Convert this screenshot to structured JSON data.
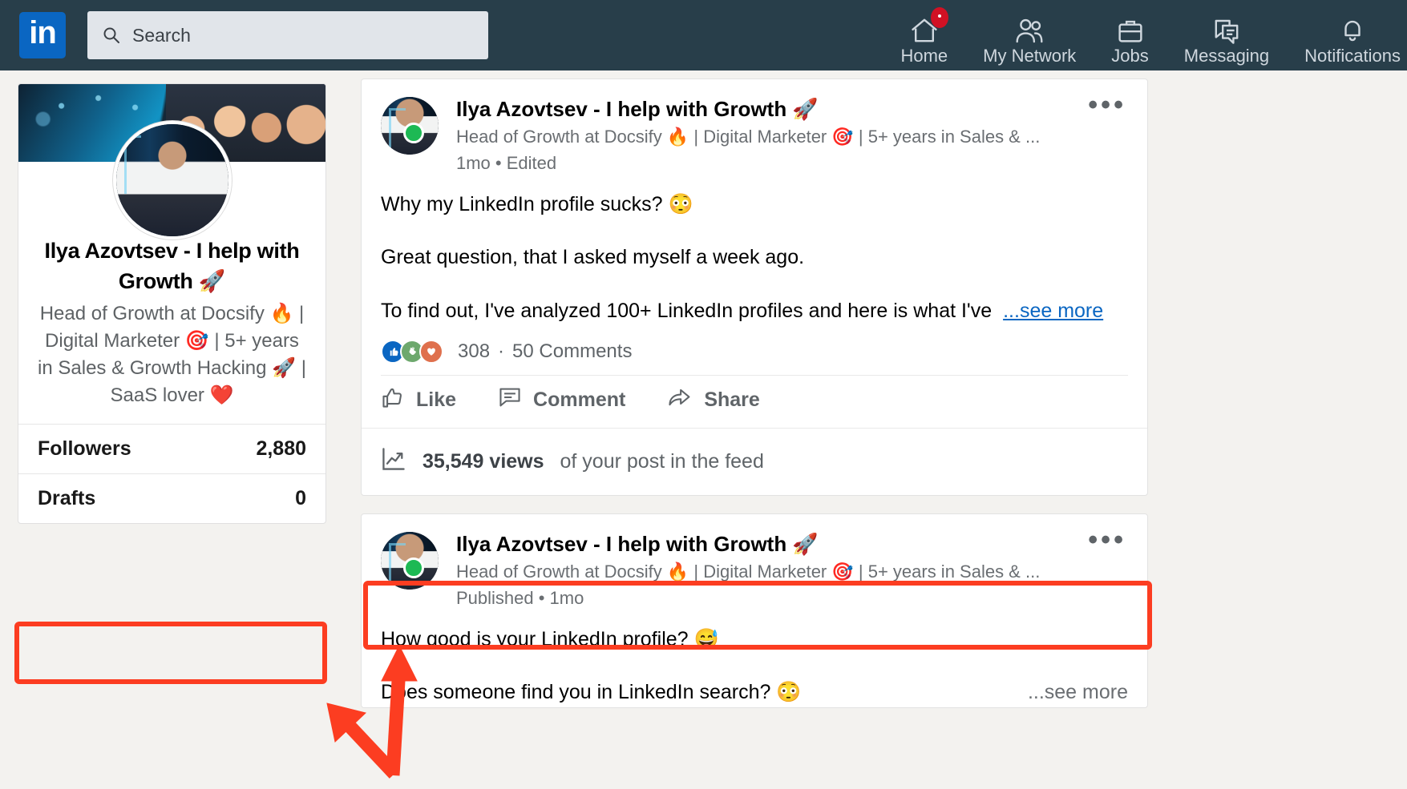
{
  "brand": {
    "logo_text": "in",
    "accent": "#0a66c2",
    "navbar_bg": "#283e4a",
    "annotation_color": "#fc3d21"
  },
  "search": {
    "placeholder": "Search",
    "icon": "search-icon"
  },
  "nav": {
    "items": [
      {
        "label": "Home",
        "icon": "home-icon",
        "badge": true
      },
      {
        "label": "My Network",
        "icon": "people-icon",
        "badge": false
      },
      {
        "label": "Jobs",
        "icon": "briefcase-icon",
        "badge": false
      },
      {
        "label": "Messaging",
        "icon": "message-icon",
        "badge": false
      },
      {
        "label": "Notifications",
        "icon": "bell-icon",
        "badge": false
      }
    ]
  },
  "profile": {
    "name": "Ilya Azovtsev - I help with Growth 🚀",
    "headline": "Head of Growth at Docsify 🔥 | Digital Marketer 🎯 | 5+ years in Sales & Growth Hacking 🚀 | SaaS lover ❤️",
    "stats": [
      {
        "label": "Followers",
        "value": "2,880"
      },
      {
        "label": "Drafts",
        "value": "0"
      }
    ]
  },
  "posts": [
    {
      "author": "Ilya Azovtsev - I help with Growth 🚀",
      "headline": "Head of Growth at Docsify 🔥 | Digital Marketer 🎯 | 5+ years in Sales & ...",
      "time": "1mo • Edited",
      "paragraphs": [
        "Why my LinkedIn profile sucks? 😳",
        "Great question, that I asked myself a week ago.",
        "To find out, I've analyzed 100+ LinkedIn profiles and here is what I've"
      ],
      "see_more": "...see more",
      "reaction_count": "308",
      "comments": "50 Comments",
      "separator": "·",
      "actions": [
        {
          "label": "Like",
          "icon": "thumbs-up-icon"
        },
        {
          "label": "Comment",
          "icon": "comment-bubble-icon"
        },
        {
          "label": "Share",
          "icon": "share-arrow-icon"
        }
      ],
      "views": {
        "icon": "analytics-chart-icon",
        "count": "35,549 views",
        "suffix": "of your post in the feed"
      }
    },
    {
      "author": "Ilya Azovtsev - I help with Growth 🚀",
      "headline": "Head of Growth at Docsify 🔥 | Digital Marketer 🎯 | 5+ years in Sales & ...",
      "time": "Published • 1mo",
      "paragraphs": [
        "How good is your LinkedIn profile? 😅",
        "Does someone find you in LinkedIn search? 😳"
      ],
      "see_more": "...see more"
    }
  ],
  "annotations": [
    {
      "name": "followers-highlight",
      "target": "Followers"
    },
    {
      "name": "views-highlight",
      "target": "35,549 views"
    }
  ]
}
